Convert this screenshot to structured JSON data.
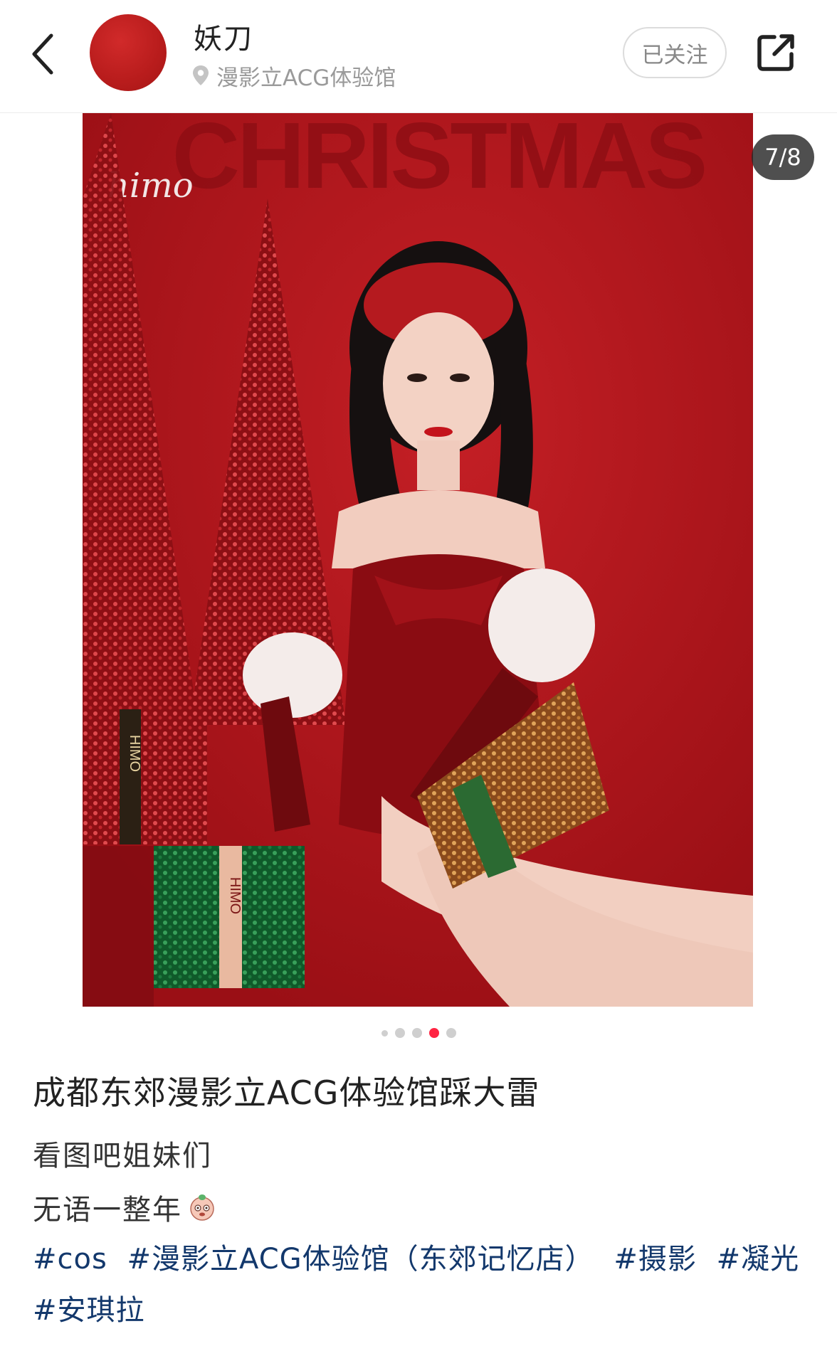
{
  "header": {
    "author_name": "妖刀",
    "location": "漫影立ACG体验馆",
    "follow_label": "已关注",
    "avatar_color": "#b81c1c"
  },
  "gallery": {
    "counter": "7/8",
    "current_index": 4,
    "dots_visible": 5,
    "photo_text": "CHRISTMAS",
    "photo_signature": "himo",
    "box_text": "HIMO"
  },
  "post": {
    "title": "成都东郊漫影立ACG体验馆踩大雷",
    "body_line1": "看图吧姐妹们",
    "body_line2": "无语一整年",
    "tags": [
      "#cos",
      "#漫影立ACG体验馆（东郊记忆店）",
      "#摄影",
      "#凝光",
      "#安琪拉"
    ]
  },
  "colors": {
    "accent": "#ff2442",
    "tag_color": "#13386c",
    "photo_background": "#a8121a"
  }
}
